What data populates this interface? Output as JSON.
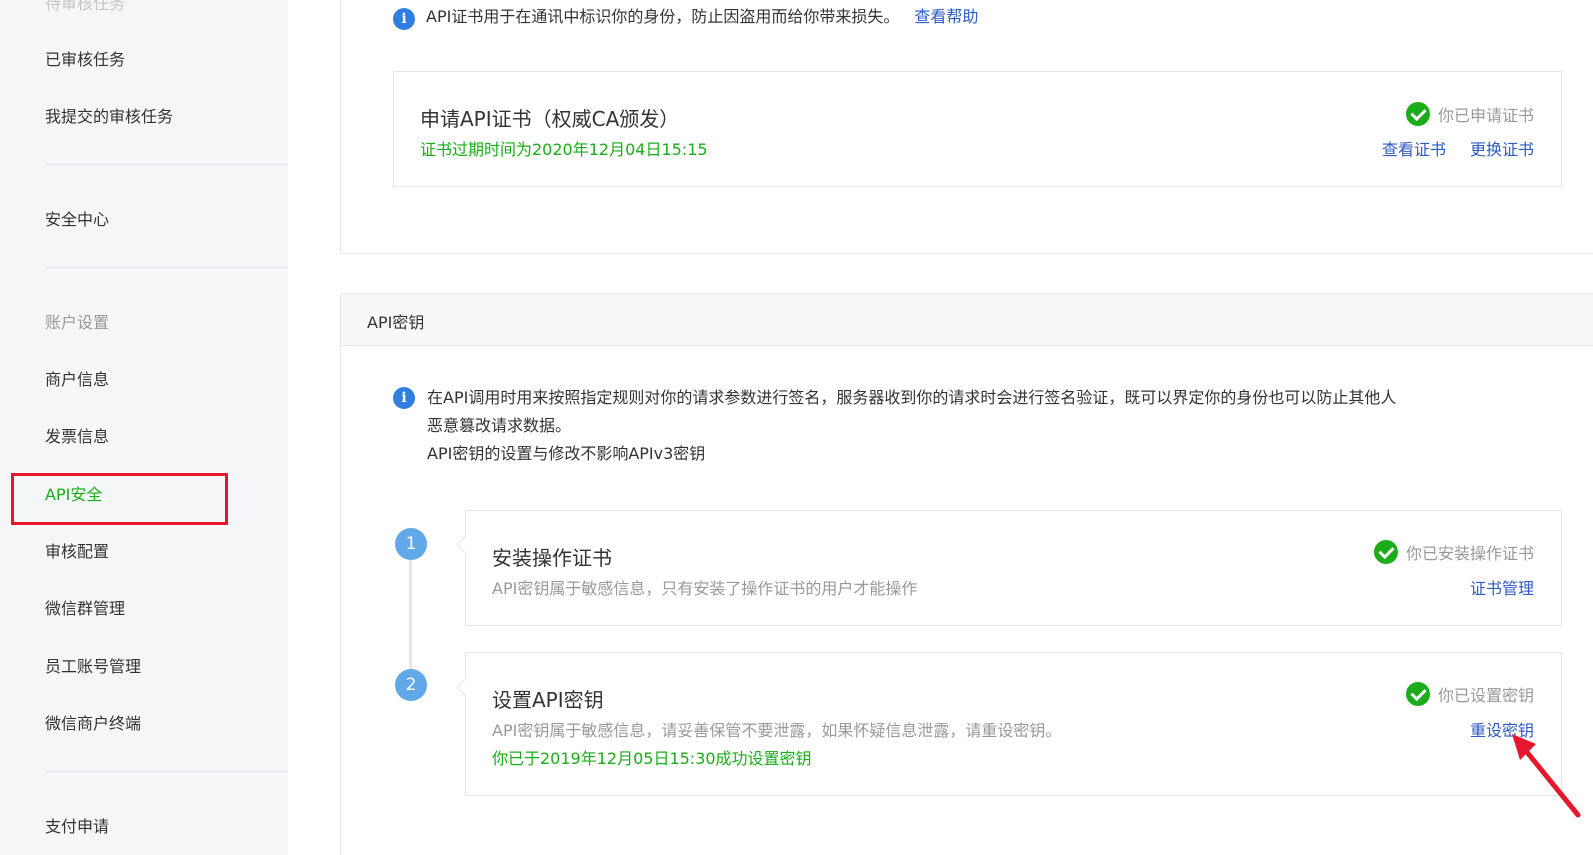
{
  "sidebar": {
    "top_partial": "待审核任务",
    "items": [
      {
        "label": "已审核任务"
      },
      {
        "label": "我提交的审核任务"
      },
      {
        "label": "安全中心"
      },
      {
        "label": "账户设置"
      },
      {
        "label": "商户信息"
      },
      {
        "label": "发票信息"
      },
      {
        "label": "API安全"
      },
      {
        "label": "审核配置"
      },
      {
        "label": "微信群管理"
      },
      {
        "label": "员工账号管理"
      },
      {
        "label": "微信商户终端"
      },
      {
        "label": "支付申请"
      }
    ]
  },
  "cert_section": {
    "info_text": "API证书用于在通讯中标识你的身份，防止因盗用而给你带来损失。",
    "help_link": "查看帮助",
    "card": {
      "title": "申请API证书（权威CA颁发）",
      "expiry": "证书过期时间为2020年12月04日15:15",
      "status": "你已申请证书",
      "view_link": "查看证书",
      "replace_link": "更换证书"
    }
  },
  "key_section": {
    "header": "API密钥",
    "info_line1": "在API调用时用来按照指定规则对你的请求参数进行签名，服务器收到你的请求时会进行签名验证，既可以界定你的身份也可以防止其他人",
    "info_line2": "恶意篡改请求数据。",
    "info_line3": "API密钥的设置与修改不影响APIv3密钥",
    "steps": [
      {
        "number": "1",
        "title": "安装操作证书",
        "desc": "API密钥属于敏感信息，只有安装了操作证书的用户才能操作",
        "status": "你已安装操作证书",
        "link": "证书管理"
      },
      {
        "number": "2",
        "title": "设置API密钥",
        "desc": "API密钥属于敏感信息，请妥善保管不要泄露，如果怀疑信息泄露，请重设密钥。",
        "green_note": "你已于2019年12月05日15:30成功设置密钥",
        "status": "你已设置密钥",
        "link": "重设密钥"
      }
    ]
  },
  "colors": {
    "accent_green": "#1aad19",
    "link_blue": "#2f5bc5",
    "highlight_red": "#e6162d",
    "info_blue": "#2f7ee0"
  }
}
